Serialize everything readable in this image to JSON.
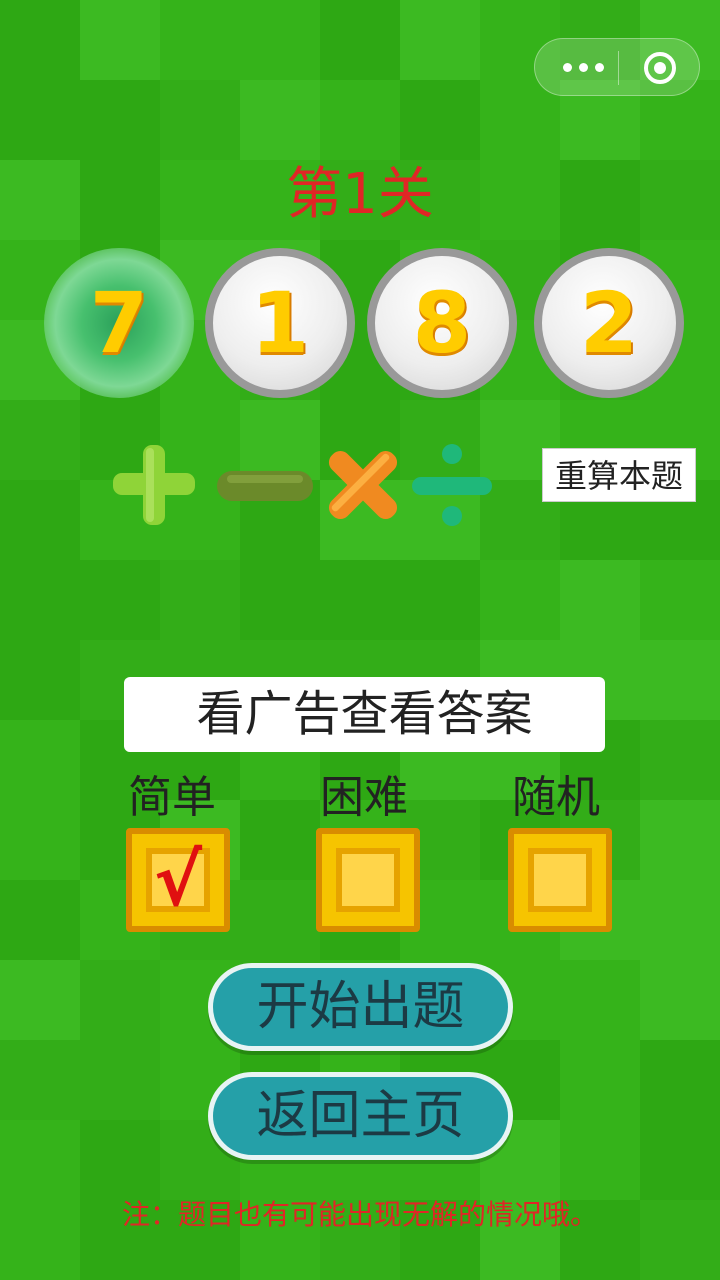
{
  "level": {
    "title": "第1关"
  },
  "numbers": [
    {
      "value": "7",
      "selected": true
    },
    {
      "value": "1",
      "selected": false
    },
    {
      "value": "8",
      "selected": false
    },
    {
      "value": "2",
      "selected": false
    }
  ],
  "operators": [
    {
      "name": "plus",
      "color": "#8fd438"
    },
    {
      "name": "minus",
      "color": "#6b8a2a"
    },
    {
      "name": "times",
      "color": "#f08a20"
    },
    {
      "name": "divide",
      "color": "#1fb87a"
    }
  ],
  "recalc_label": "重算本题",
  "answer_label": "看广告查看答案",
  "difficulty": [
    {
      "label": "简单",
      "checked": true,
      "mark": "√"
    },
    {
      "label": "困难",
      "checked": false,
      "mark": ""
    },
    {
      "label": "随机",
      "checked": false,
      "mark": ""
    }
  ],
  "buttons": {
    "start": "开始出题",
    "home": "返回主页"
  },
  "note": "注：题目也有可能出现无解的情况哦。",
  "colors": {
    "background": "#35b31a",
    "accent_red": "#e02626",
    "button_teal": "#25a0a8"
  }
}
